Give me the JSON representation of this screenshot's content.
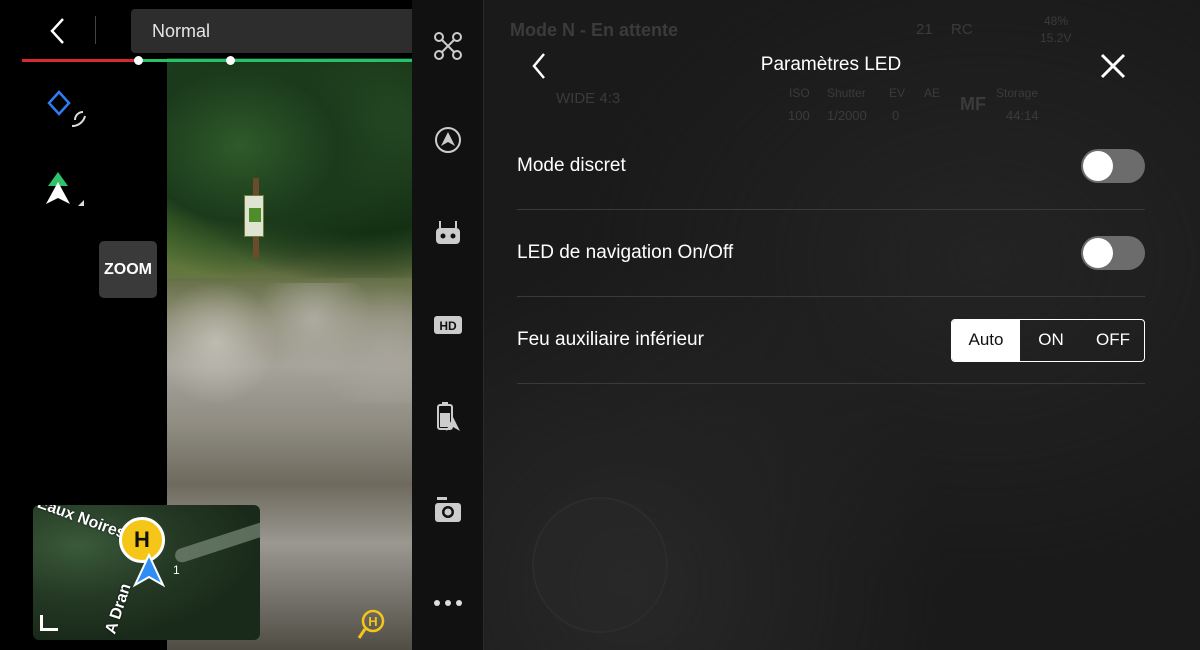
{
  "top": {
    "mode_label": "Normal"
  },
  "left": {
    "zoom_label": "ZOOM"
  },
  "map": {
    "label_top": "Eaux Noires",
    "label_bottom": "A Dran",
    "home_letter": "H",
    "number": "1"
  },
  "status_ghost": {
    "mode": "Mode N - En attente",
    "satellites": "21",
    "rc": "RC",
    "battery": "48%",
    "voltage": "15.2V",
    "iso_label": "ISO",
    "iso_value": "100",
    "shutter_label": "Shutter",
    "shutter_value": "1/2000",
    "ev_label": "EV",
    "ev_value": "0",
    "ae_label": "AE",
    "mf_label": "MF",
    "storage_label": "Storage",
    "storage_value": "44:14",
    "wide_label": "WIDE 4:3"
  },
  "panel": {
    "title": "Paramètres LED",
    "rows": [
      {
        "label": "Mode discret",
        "type": "toggle",
        "value": false
      },
      {
        "label": "LED de navigation On/Off",
        "type": "toggle",
        "value": false
      },
      {
        "label": "Feu auxiliaire inférieur",
        "type": "segmented",
        "options": [
          "Auto",
          "ON",
          "OFF"
        ],
        "selected": "Auto"
      }
    ]
  },
  "sidebar": {
    "items": [
      "drone-icon",
      "obstacle-avoidance-icon",
      "remote-controller-icon",
      "hd-transmission-icon",
      "battery-icon",
      "camera-settings-icon",
      "more-icon"
    ],
    "hd_text": "HD"
  }
}
